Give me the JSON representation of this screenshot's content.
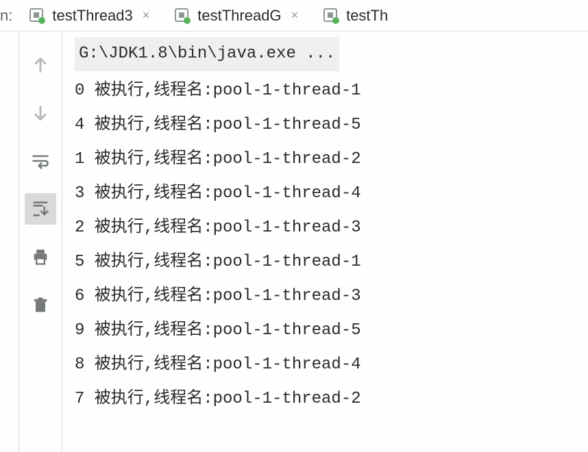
{
  "run_label": "n:",
  "tabs": [
    {
      "label": "testThread3",
      "closable": true
    },
    {
      "label": "testThreadG",
      "closable": true
    },
    {
      "label": "testTh",
      "closable": false
    }
  ],
  "console": {
    "header": "G:\\JDK1.8\\bin\\java.exe ...",
    "lines": [
      "0 被执行,线程名:pool-1-thread-1",
      "4 被执行,线程名:pool-1-thread-5",
      "1 被执行,线程名:pool-1-thread-2",
      "3 被执行,线程名:pool-1-thread-4",
      "2 被执行,线程名:pool-1-thread-3",
      "5 被执行,线程名:pool-1-thread-1",
      "6 被执行,线程名:pool-1-thread-3",
      "9 被执行,线程名:pool-1-thread-5",
      "8 被执行,线程名:pool-1-thread-4",
      "7 被执行,线程名:pool-1-thread-2"
    ]
  },
  "toolbar": {
    "up": "up",
    "down": "down",
    "wrap": "wrap",
    "scroll": "scroll-to-end",
    "print": "print",
    "delete": "delete"
  }
}
